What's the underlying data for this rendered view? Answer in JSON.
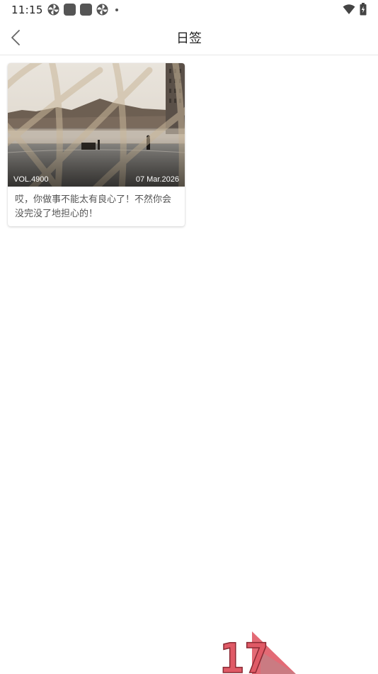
{
  "status_bar": {
    "time": "11:15",
    "left_icons": [
      "pinwheel-icon",
      "app-square-icon",
      "app-square-icon",
      "pinwheel-icon",
      "dot-icon"
    ],
    "right_icons": [
      "wifi-icon",
      "battery-icon"
    ]
  },
  "header": {
    "title": "日签",
    "back_icon": "chevron-left-icon"
  },
  "cards": [
    {
      "vol": "VOL.4900",
      "date": "07 Mar.2026",
      "text": "哎，你做事不能太有良心了！不然你会没完没了地担心的！",
      "image": "photo-through-net-fence"
    }
  ],
  "watermark": {
    "text": "17"
  },
  "colors": {
    "background": "#ffffff",
    "title_text": "#222222",
    "body_text": "#555555",
    "divider": "#e8e8e8",
    "watermark_red": "#e05a66"
  }
}
